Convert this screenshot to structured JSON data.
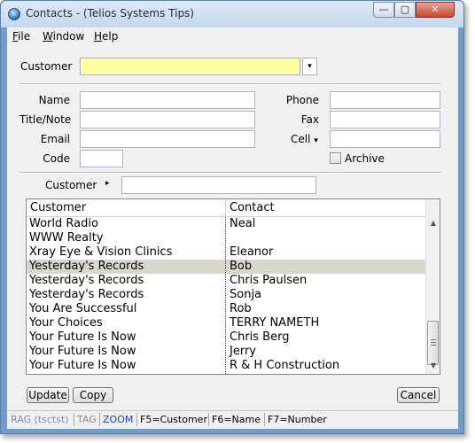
{
  "window": {
    "title": "Contacts - (Telios Systems Tips)",
    "minimize": "—",
    "maximize": "▢",
    "close": "✕"
  },
  "menu": {
    "file": "File",
    "window": "Window",
    "help": "Help"
  },
  "form": {
    "customer_label": "Customer",
    "customer_value": "",
    "name_label": "Name",
    "title_label": "Title/Note",
    "email_label": "Email",
    "code_label": "Code",
    "phone_label": "Phone",
    "fax_label": "Fax",
    "cell_label": "Cell",
    "cell_arrow": "▾",
    "archive_label": "Archive",
    "archive_checked": false,
    "filter_label": "Customer",
    "filter_arrow": "▸",
    "dropdown_arrow": "▾"
  },
  "list": {
    "columns": [
      "Customer",
      "Contact"
    ],
    "rows": [
      {
        "customer": "World Radio",
        "contact": "Neal"
      },
      {
        "customer": "WWW Realty",
        "contact": ""
      },
      {
        "customer": "Xray Eye & Vision Clinics",
        "contact": "Eleanor"
      },
      {
        "customer": "Yesterday's Records",
        "contact": "Bob",
        "selected": true
      },
      {
        "customer": "Yesterday's Records",
        "contact": "Chris Paulsen"
      },
      {
        "customer": "Yesterday's Records",
        "contact": "Sonja"
      },
      {
        "customer": "You Are Successful",
        "contact": "Rob"
      },
      {
        "customer": "Your Choices",
        "contact": "TERRY NAMETH"
      },
      {
        "customer": "Your Future Is Now",
        "contact": "Chris Berg"
      },
      {
        "customer": "Your Future Is Now",
        "contact": "Jerry"
      },
      {
        "customer": "Your Future Is Now",
        "contact": "R & H Construction"
      }
    ],
    "scroll_up": "▲",
    "scroll_down": "▼"
  },
  "buttons": {
    "update": "Update",
    "copy": "Copy",
    "cancel": "Cancel"
  },
  "status": {
    "rag": "RAG (tsctst)",
    "tag": "TAG",
    "zoom": "ZOOM",
    "f5": "F5=Customer",
    "f6": "F6=Name",
    "f7": "F7=Number",
    "rag_color": "#7a8fc0",
    "zoom_color": "#1a3fd6"
  }
}
